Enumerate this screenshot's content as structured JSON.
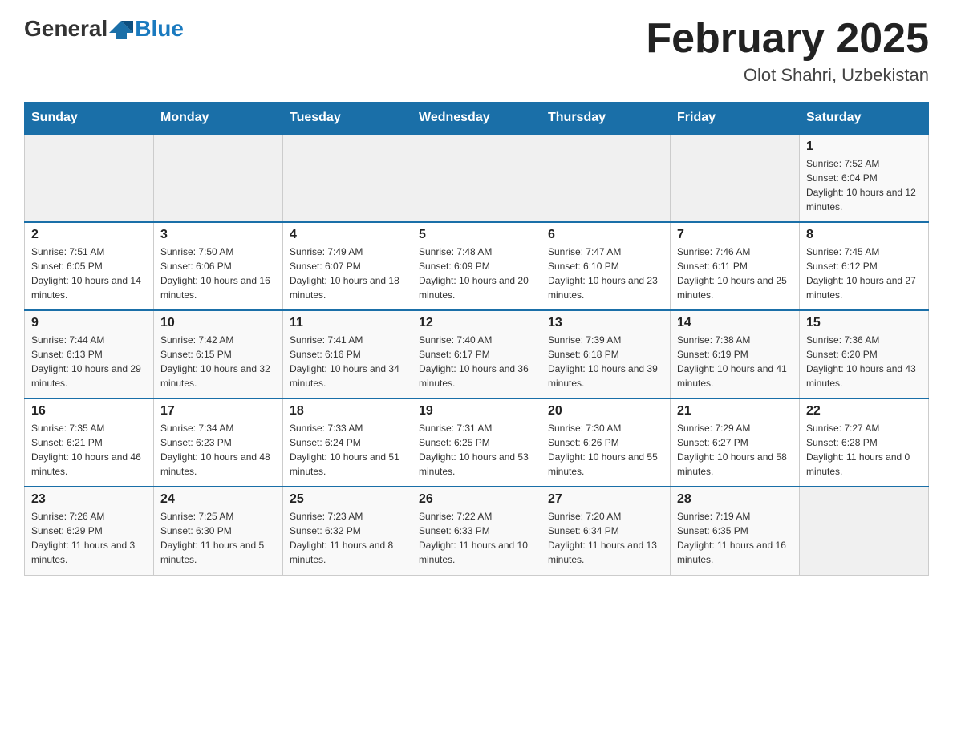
{
  "header": {
    "title": "February 2025",
    "location": "Olot Shahri, Uzbekistan",
    "logo_general": "General",
    "logo_blue": "Blue"
  },
  "days_of_week": [
    "Sunday",
    "Monday",
    "Tuesday",
    "Wednesday",
    "Thursday",
    "Friday",
    "Saturday"
  ],
  "weeks": [
    [
      {
        "day": "",
        "sunrise": "",
        "sunset": "",
        "daylight": ""
      },
      {
        "day": "",
        "sunrise": "",
        "sunset": "",
        "daylight": ""
      },
      {
        "day": "",
        "sunrise": "",
        "sunset": "",
        "daylight": ""
      },
      {
        "day": "",
        "sunrise": "",
        "sunset": "",
        "daylight": ""
      },
      {
        "day": "",
        "sunrise": "",
        "sunset": "",
        "daylight": ""
      },
      {
        "day": "",
        "sunrise": "",
        "sunset": "",
        "daylight": ""
      },
      {
        "day": "1",
        "sunrise": "Sunrise: 7:52 AM",
        "sunset": "Sunset: 6:04 PM",
        "daylight": "Daylight: 10 hours and 12 minutes."
      }
    ],
    [
      {
        "day": "2",
        "sunrise": "Sunrise: 7:51 AM",
        "sunset": "Sunset: 6:05 PM",
        "daylight": "Daylight: 10 hours and 14 minutes."
      },
      {
        "day": "3",
        "sunrise": "Sunrise: 7:50 AM",
        "sunset": "Sunset: 6:06 PM",
        "daylight": "Daylight: 10 hours and 16 minutes."
      },
      {
        "day": "4",
        "sunrise": "Sunrise: 7:49 AM",
        "sunset": "Sunset: 6:07 PM",
        "daylight": "Daylight: 10 hours and 18 minutes."
      },
      {
        "day": "5",
        "sunrise": "Sunrise: 7:48 AM",
        "sunset": "Sunset: 6:09 PM",
        "daylight": "Daylight: 10 hours and 20 minutes."
      },
      {
        "day": "6",
        "sunrise": "Sunrise: 7:47 AM",
        "sunset": "Sunset: 6:10 PM",
        "daylight": "Daylight: 10 hours and 23 minutes."
      },
      {
        "day": "7",
        "sunrise": "Sunrise: 7:46 AM",
        "sunset": "Sunset: 6:11 PM",
        "daylight": "Daylight: 10 hours and 25 minutes."
      },
      {
        "day": "8",
        "sunrise": "Sunrise: 7:45 AM",
        "sunset": "Sunset: 6:12 PM",
        "daylight": "Daylight: 10 hours and 27 minutes."
      }
    ],
    [
      {
        "day": "9",
        "sunrise": "Sunrise: 7:44 AM",
        "sunset": "Sunset: 6:13 PM",
        "daylight": "Daylight: 10 hours and 29 minutes."
      },
      {
        "day": "10",
        "sunrise": "Sunrise: 7:42 AM",
        "sunset": "Sunset: 6:15 PM",
        "daylight": "Daylight: 10 hours and 32 minutes."
      },
      {
        "day": "11",
        "sunrise": "Sunrise: 7:41 AM",
        "sunset": "Sunset: 6:16 PM",
        "daylight": "Daylight: 10 hours and 34 minutes."
      },
      {
        "day": "12",
        "sunrise": "Sunrise: 7:40 AM",
        "sunset": "Sunset: 6:17 PM",
        "daylight": "Daylight: 10 hours and 36 minutes."
      },
      {
        "day": "13",
        "sunrise": "Sunrise: 7:39 AM",
        "sunset": "Sunset: 6:18 PM",
        "daylight": "Daylight: 10 hours and 39 minutes."
      },
      {
        "day": "14",
        "sunrise": "Sunrise: 7:38 AM",
        "sunset": "Sunset: 6:19 PM",
        "daylight": "Daylight: 10 hours and 41 minutes."
      },
      {
        "day": "15",
        "sunrise": "Sunrise: 7:36 AM",
        "sunset": "Sunset: 6:20 PM",
        "daylight": "Daylight: 10 hours and 43 minutes."
      }
    ],
    [
      {
        "day": "16",
        "sunrise": "Sunrise: 7:35 AM",
        "sunset": "Sunset: 6:21 PM",
        "daylight": "Daylight: 10 hours and 46 minutes."
      },
      {
        "day": "17",
        "sunrise": "Sunrise: 7:34 AM",
        "sunset": "Sunset: 6:23 PM",
        "daylight": "Daylight: 10 hours and 48 minutes."
      },
      {
        "day": "18",
        "sunrise": "Sunrise: 7:33 AM",
        "sunset": "Sunset: 6:24 PM",
        "daylight": "Daylight: 10 hours and 51 minutes."
      },
      {
        "day": "19",
        "sunrise": "Sunrise: 7:31 AM",
        "sunset": "Sunset: 6:25 PM",
        "daylight": "Daylight: 10 hours and 53 minutes."
      },
      {
        "day": "20",
        "sunrise": "Sunrise: 7:30 AM",
        "sunset": "Sunset: 6:26 PM",
        "daylight": "Daylight: 10 hours and 55 minutes."
      },
      {
        "day": "21",
        "sunrise": "Sunrise: 7:29 AM",
        "sunset": "Sunset: 6:27 PM",
        "daylight": "Daylight: 10 hours and 58 minutes."
      },
      {
        "day": "22",
        "sunrise": "Sunrise: 7:27 AM",
        "sunset": "Sunset: 6:28 PM",
        "daylight": "Daylight: 11 hours and 0 minutes."
      }
    ],
    [
      {
        "day": "23",
        "sunrise": "Sunrise: 7:26 AM",
        "sunset": "Sunset: 6:29 PM",
        "daylight": "Daylight: 11 hours and 3 minutes."
      },
      {
        "day": "24",
        "sunrise": "Sunrise: 7:25 AM",
        "sunset": "Sunset: 6:30 PM",
        "daylight": "Daylight: 11 hours and 5 minutes."
      },
      {
        "day": "25",
        "sunrise": "Sunrise: 7:23 AM",
        "sunset": "Sunset: 6:32 PM",
        "daylight": "Daylight: 11 hours and 8 minutes."
      },
      {
        "day": "26",
        "sunrise": "Sunrise: 7:22 AM",
        "sunset": "Sunset: 6:33 PM",
        "daylight": "Daylight: 11 hours and 10 minutes."
      },
      {
        "day": "27",
        "sunrise": "Sunrise: 7:20 AM",
        "sunset": "Sunset: 6:34 PM",
        "daylight": "Daylight: 11 hours and 13 minutes."
      },
      {
        "day": "28",
        "sunrise": "Sunrise: 7:19 AM",
        "sunset": "Sunset: 6:35 PM",
        "daylight": "Daylight: 11 hours and 16 minutes."
      },
      {
        "day": "",
        "sunrise": "",
        "sunset": "",
        "daylight": ""
      }
    ]
  ]
}
